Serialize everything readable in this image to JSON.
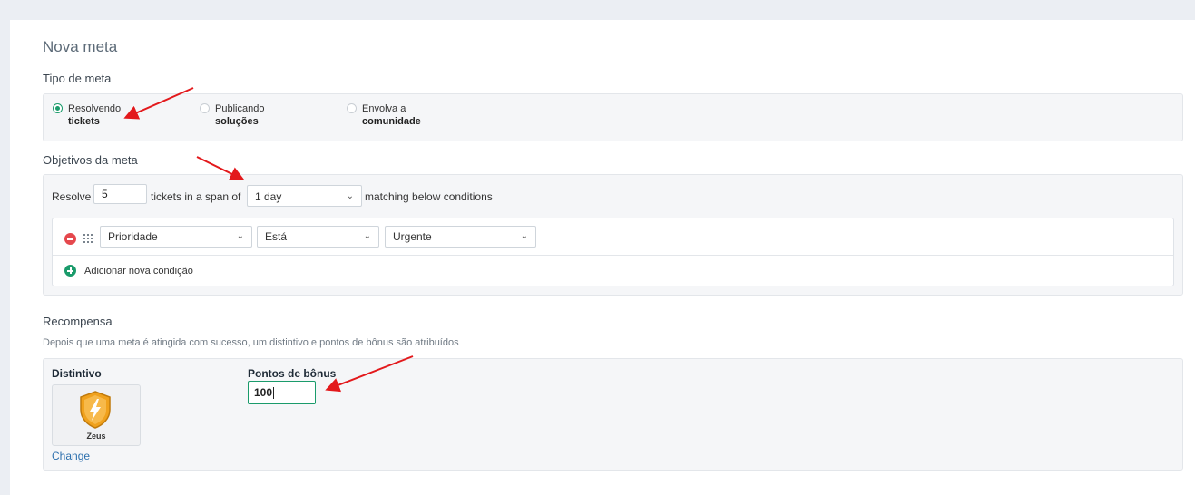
{
  "page": {
    "title": "Nova meta"
  },
  "goal_type": {
    "section_title": "Tipo de meta",
    "options": [
      {
        "line1": "Resolvendo",
        "line2": "tickets",
        "selected": true
      },
      {
        "line1": "Publicando",
        "line2": "soluções",
        "selected": false
      },
      {
        "line1": "Envolva a",
        "line2": "comunidade",
        "selected": false
      }
    ]
  },
  "objectives": {
    "section_title": "Objetivos da meta",
    "prefix": "Resolve",
    "count_value": "5",
    "middle": "tickets in a span of",
    "span_value": "1 day",
    "suffix": "matching below conditions",
    "condition": {
      "field": "Prioridade",
      "operator": "Está",
      "value": "Urgente"
    },
    "add_condition_label": "Adicionar nova condição"
  },
  "reward": {
    "section_title": "Recompensa",
    "description": "Depois que uma meta é atingida com sucesso, um distintivo e pontos de bônus são atribuídos",
    "badge_label": "Distintivo",
    "badge_name": "Zeus",
    "change_label": "Change",
    "bonus_label": "Pontos de bônus",
    "bonus_value": "100"
  },
  "colors": {
    "accent": "#1a9b6b",
    "badge_orange": "#f0a11c",
    "arrow_red": "#e3191c"
  }
}
